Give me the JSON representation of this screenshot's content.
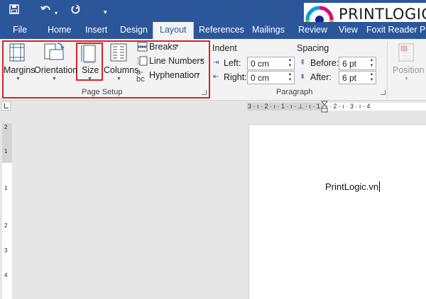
{
  "quick_access": {
    "save_icon": "save-icon",
    "undo_icon": "undo-icon",
    "redo_icon": "redo-icon",
    "customize_icon": "customize-icon"
  },
  "brand": {
    "logo_text": "PRINTLOGIC",
    "logo_colors": [
      "#e6007e",
      "#00a0e9",
      "#f39800",
      "#8fc31f",
      "#1d2088"
    ]
  },
  "tabs": [
    {
      "label": "File"
    },
    {
      "label": "Home"
    },
    {
      "label": "Insert"
    },
    {
      "label": "Design"
    },
    {
      "label": "Layout",
      "active": true
    },
    {
      "label": "References"
    },
    {
      "label": "Mailings"
    },
    {
      "label": "Review"
    },
    {
      "label": "View"
    },
    {
      "label": "Foxit Reader PDF"
    }
  ],
  "page_setup": {
    "margins_label": "Margins",
    "orientation_label": "Orientation",
    "size_label": "Size",
    "columns_label": "Columns",
    "breaks_label": "Breaks",
    "line_numbers_label": "Line Numbers",
    "hyphenation_label": "Hyphenation",
    "group_label": "Page Setup"
  },
  "paragraph": {
    "indent_label": "Indent",
    "spacing_label": "Spacing",
    "left_label": "Left:",
    "right_label": "Right:",
    "left_value": "0 cm",
    "right_value": "0 cm",
    "before_label": "Before:",
    "after_label": "After:",
    "before_value": "6 pt",
    "after_value": "6 pt",
    "group_label": "Paragraph"
  },
  "arrange": {
    "position_label": "Position"
  },
  "ruler": {
    "horizontal_text": "3 · ı · 2 · ı · 1 · ı · ⊥ · ı · 1 · ı · 2 · ı · 3 · ı · 4",
    "vertical_numbers": [
      "2",
      "1",
      "1",
      "2",
      "3",
      "4"
    ]
  },
  "document": {
    "text": "PrintLogic.vn"
  },
  "colors": {
    "accent": "#2b579a",
    "highlight_box": "#d9232a",
    "ribbon_bg": "#f3f3f3"
  }
}
